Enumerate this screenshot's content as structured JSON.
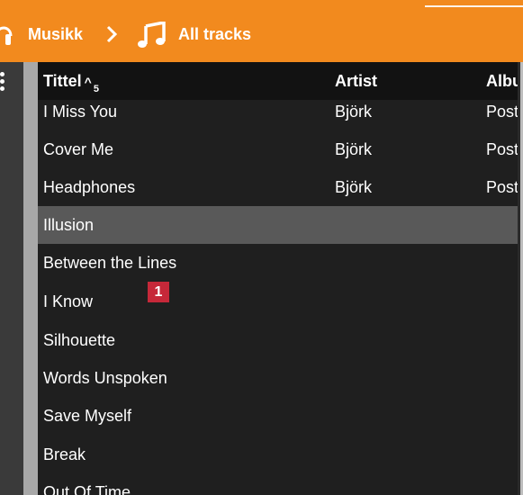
{
  "breadcrumb": {
    "root_label": "Musikk",
    "current_label": "All tracks",
    "root_icon": "headphones-icon",
    "separator_icon": "chevron-right-icon",
    "current_icon": "music-note-icon"
  },
  "table": {
    "columns": [
      {
        "label": "Tittel",
        "sort_indicator": "^",
        "sort_number": "5"
      },
      {
        "label": "Artist"
      },
      {
        "label": "Albu"
      }
    ],
    "rows": [
      {
        "title": "I Miss You",
        "artist": "Björk",
        "album": "Post"
      },
      {
        "title": "Cover Me",
        "artist": "Björk",
        "album": "Post"
      },
      {
        "title": "Headphones",
        "artist": "Björk",
        "album": "Post"
      },
      {
        "title": "Illusion",
        "artist": "",
        "album": ""
      },
      {
        "title": "Between the Lines",
        "artist": "",
        "album": ""
      },
      {
        "title": "I Know",
        "artist": "",
        "album": ""
      },
      {
        "title": "Silhouette",
        "artist": "",
        "album": ""
      },
      {
        "title": "Words Unspoken",
        "artist": "",
        "album": ""
      },
      {
        "title": "Save Myself",
        "artist": "",
        "album": ""
      },
      {
        "title": "Break",
        "artist": "",
        "album": ""
      },
      {
        "title": "Out Of Time",
        "artist": "",
        "album": ""
      }
    ],
    "selected_row": "Illusion"
  },
  "callout": {
    "label": "1"
  },
  "colors": {
    "accent": "#f28a1e",
    "background": "#1f1f1f",
    "header": "#121212",
    "selected": "#595959",
    "callout": "#c62839"
  }
}
